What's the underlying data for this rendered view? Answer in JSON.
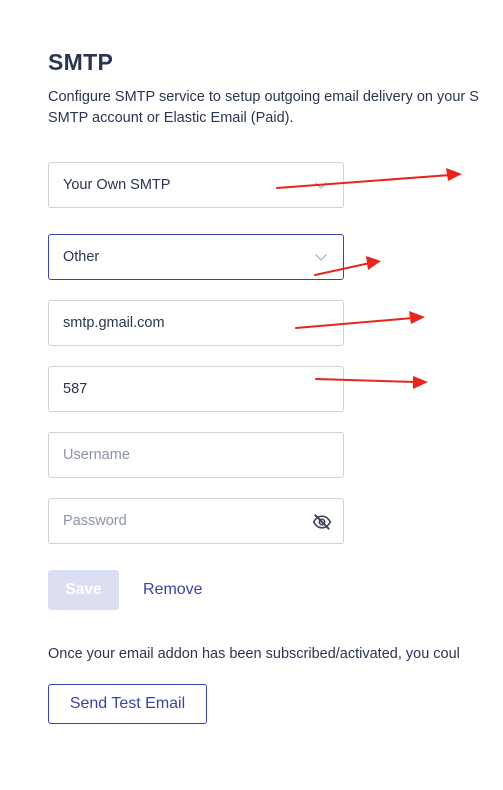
{
  "section": {
    "title": "SMTP",
    "description_line1": "Configure SMTP service to setup outgoing email delivery on your S",
    "description_line2": "SMTP account or Elastic Email (Paid)."
  },
  "form": {
    "provider_select": {
      "value": "Your Own SMTP"
    },
    "server_select": {
      "value": "Other"
    },
    "host_input": {
      "value": "smtp.gmail.com"
    },
    "port_input": {
      "value": "587"
    },
    "username_input": {
      "placeholder": "Username"
    },
    "password_input": {
      "placeholder": "Password"
    }
  },
  "actions": {
    "save_label": "Save",
    "remove_label": "Remove"
  },
  "note": "Once your email addon has been subscribed/activated, you coul",
  "test_email_label": "Send Test Email",
  "colors": {
    "primary": "#3a43a6",
    "text": "#2b3552",
    "disabled_button": "#dcdef2",
    "annotation_arrow": "#e8251c"
  },
  "icons": {
    "select_chevron": "chevron-down-icon",
    "password_toggle": "eye-off-icon"
  }
}
